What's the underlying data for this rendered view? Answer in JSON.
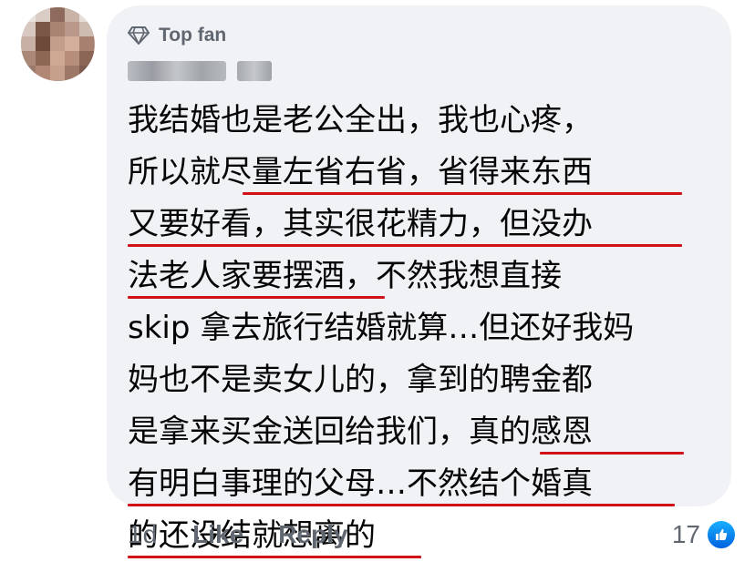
{
  "comment": {
    "badge": "Top fan",
    "lines": [
      "我结婚也是老公全出，我也心疼，",
      "所以就尽量左省右省，省得来东西",
      "又要好看，其实很花精力，但没办",
      "法老人家要摆酒，不然我想直接",
      "skip 拿去旅行结婚就算…但还好我妈",
      "妈也不是卖女儿的，拿到的聘金都",
      "是拿来买金送回给我们，真的感恩",
      "有明白事理的父母…不然结个婚真",
      "的还没结就想离的"
    ],
    "time": "1d",
    "like_label": "Like",
    "reply_label": "Reply",
    "reaction_count": "17"
  },
  "colors": {
    "bubble": "#f0f2f5",
    "underline": "#d01218",
    "meta_text": "#606770",
    "like_blue": "#1877f2"
  }
}
